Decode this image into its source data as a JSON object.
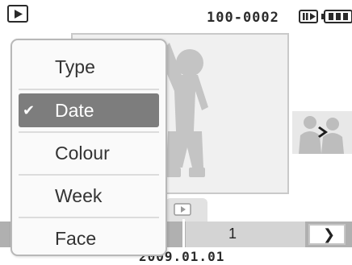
{
  "header": {
    "file_number": "100-0002"
  },
  "icons": {
    "mode": "playback-mode-icon",
    "memory": "internal-memory-icon",
    "battery": "battery-full-icon",
    "thumbnail_nav": "thumbnail-next-icon",
    "tab": "folder-tab-icon",
    "next": "next-arrow-icon"
  },
  "menu": {
    "items": [
      {
        "label": "Type",
        "selected": false
      },
      {
        "label": "Date",
        "selected": true
      },
      {
        "label": "Colour",
        "selected": false
      },
      {
        "label": "Week",
        "selected": false
      },
      {
        "label": "Face",
        "selected": false
      }
    ],
    "check_glyph": "✔"
  },
  "bottom": {
    "page": "1",
    "next_glyph": "❯",
    "date": "2009.01.01"
  },
  "colors": {
    "highlight": "#7d7d7d",
    "bar": "#b0b0b0",
    "bar_light": "#d4d4d4"
  }
}
